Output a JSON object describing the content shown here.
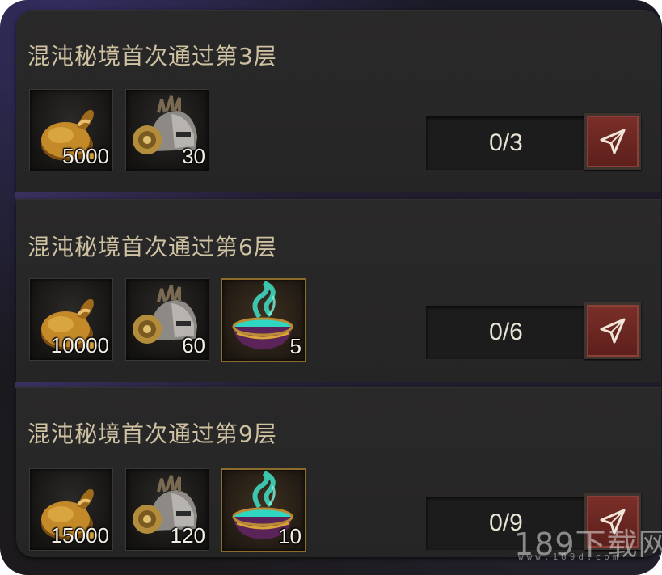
{
  "colors": {
    "title_text": "#cfc2a3",
    "go_button": "#7b2f29",
    "rare_border": "#8c6c2a",
    "panel_bg": "#2a2929"
  },
  "tasks": [
    {
      "title": "混沌秘境首次通过第3层",
      "progress": "0/3",
      "rewards": [
        {
          "icon": "gold-pouch-icon",
          "qty": "5000"
        },
        {
          "icon": "helmet-icon",
          "qty": "30"
        }
      ]
    },
    {
      "title": "混沌秘境首次通过第6层",
      "progress": "0/6",
      "rewards": [
        {
          "icon": "gold-pouch-icon",
          "qty": "10000"
        },
        {
          "icon": "helmet-icon",
          "qty": "60"
        },
        {
          "icon": "cauldron-icon",
          "qty": "5"
        }
      ]
    },
    {
      "title": "混沌秘境首次通过第9层",
      "progress": "0/9",
      "rewards": [
        {
          "icon": "gold-pouch-icon",
          "qty": "15000"
        },
        {
          "icon": "helmet-icon",
          "qty": "120"
        },
        {
          "icon": "cauldron-icon",
          "qty": "10"
        }
      ]
    }
  ],
  "watermark": {
    "main": "189下载网",
    "sub": "www.189d.com"
  }
}
